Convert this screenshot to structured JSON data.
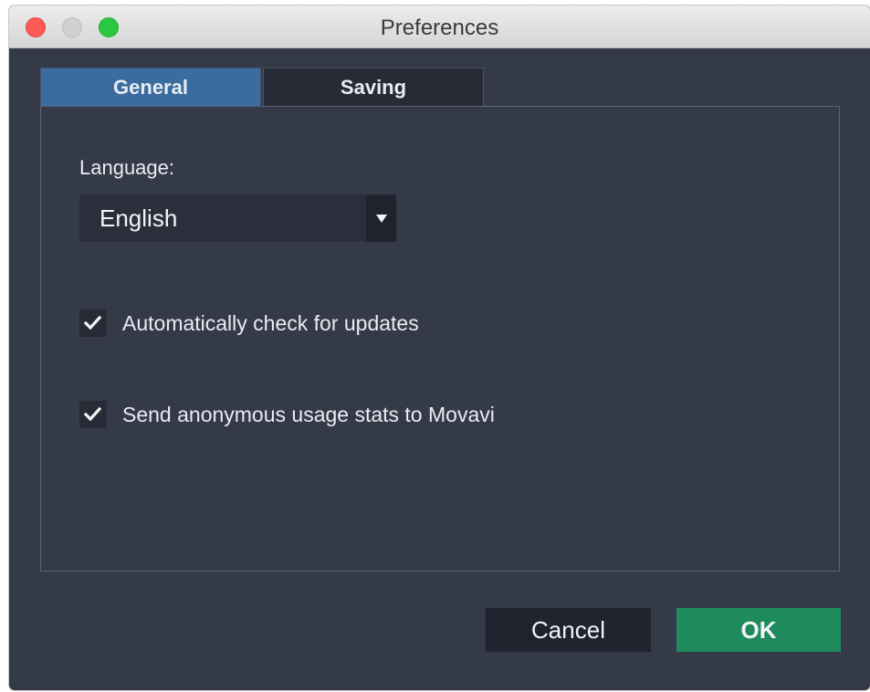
{
  "window": {
    "title": "Preferences"
  },
  "tabs": [
    {
      "label": "General",
      "active": true
    },
    {
      "label": "Saving",
      "active": false
    }
  ],
  "general": {
    "language_label": "Language:",
    "language_selected": "English",
    "checkboxes": [
      {
        "label": "Automatically check for updates",
        "checked": true
      },
      {
        "label": "Send anonymous usage stats to Movavi",
        "checked": true
      }
    ]
  },
  "buttons": {
    "cancel": "Cancel",
    "ok": "OK"
  },
  "colors": {
    "background": "#353a48",
    "tab_active": "#3a6c9f",
    "tab_inactive": "#262b36",
    "ok_button": "#1f8a5c",
    "cancel_button": "#1f232d",
    "traffic_close": "#fc5b57",
    "traffic_min": "#d0d0d0",
    "traffic_max": "#2ac840"
  },
  "icons": {
    "close": "close-dot-icon",
    "minimize": "minimize-dot-icon",
    "maximize": "maximize-dot-icon",
    "dropdown": "triangle-down-icon",
    "checkmark": "checkmark-icon"
  }
}
